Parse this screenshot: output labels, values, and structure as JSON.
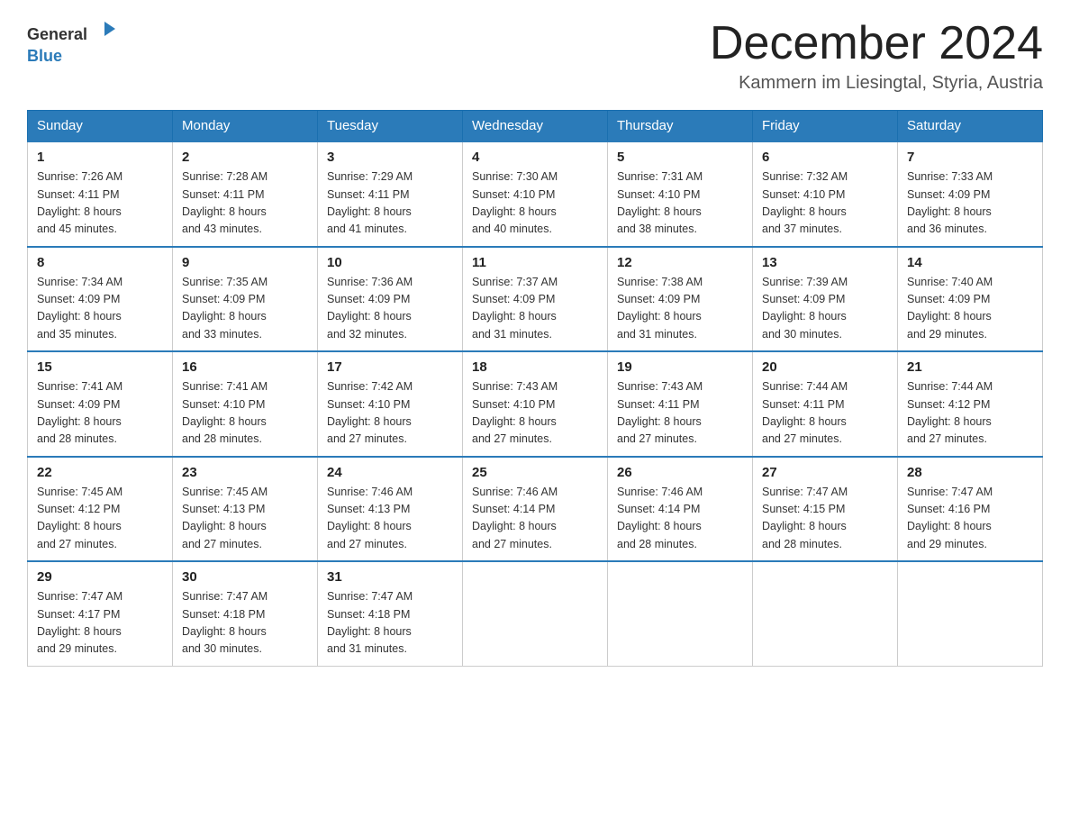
{
  "logo": {
    "text_general": "General",
    "text_blue": "Blue"
  },
  "title": {
    "month_year": "December 2024",
    "location": "Kammern im Liesingtal, Styria, Austria"
  },
  "days_of_week": [
    "Sunday",
    "Monday",
    "Tuesday",
    "Wednesday",
    "Thursday",
    "Friday",
    "Saturday"
  ],
  "weeks": [
    [
      {
        "day": "1",
        "sunrise": "7:26 AM",
        "sunset": "4:11 PM",
        "daylight": "8 hours and 45 minutes."
      },
      {
        "day": "2",
        "sunrise": "7:28 AM",
        "sunset": "4:11 PM",
        "daylight": "8 hours and 43 minutes."
      },
      {
        "day": "3",
        "sunrise": "7:29 AM",
        "sunset": "4:11 PM",
        "daylight": "8 hours and 41 minutes."
      },
      {
        "day": "4",
        "sunrise": "7:30 AM",
        "sunset": "4:10 PM",
        "daylight": "8 hours and 40 minutes."
      },
      {
        "day": "5",
        "sunrise": "7:31 AM",
        "sunset": "4:10 PM",
        "daylight": "8 hours and 38 minutes."
      },
      {
        "day": "6",
        "sunrise": "7:32 AM",
        "sunset": "4:10 PM",
        "daylight": "8 hours and 37 minutes."
      },
      {
        "day": "7",
        "sunrise": "7:33 AM",
        "sunset": "4:09 PM",
        "daylight": "8 hours and 36 minutes."
      }
    ],
    [
      {
        "day": "8",
        "sunrise": "7:34 AM",
        "sunset": "4:09 PM",
        "daylight": "8 hours and 35 minutes."
      },
      {
        "day": "9",
        "sunrise": "7:35 AM",
        "sunset": "4:09 PM",
        "daylight": "8 hours and 33 minutes."
      },
      {
        "day": "10",
        "sunrise": "7:36 AM",
        "sunset": "4:09 PM",
        "daylight": "8 hours and 32 minutes."
      },
      {
        "day": "11",
        "sunrise": "7:37 AM",
        "sunset": "4:09 PM",
        "daylight": "8 hours and 31 minutes."
      },
      {
        "day": "12",
        "sunrise": "7:38 AM",
        "sunset": "4:09 PM",
        "daylight": "8 hours and 31 minutes."
      },
      {
        "day": "13",
        "sunrise": "7:39 AM",
        "sunset": "4:09 PM",
        "daylight": "8 hours and 30 minutes."
      },
      {
        "day": "14",
        "sunrise": "7:40 AM",
        "sunset": "4:09 PM",
        "daylight": "8 hours and 29 minutes."
      }
    ],
    [
      {
        "day": "15",
        "sunrise": "7:41 AM",
        "sunset": "4:09 PM",
        "daylight": "8 hours and 28 minutes."
      },
      {
        "day": "16",
        "sunrise": "7:41 AM",
        "sunset": "4:10 PM",
        "daylight": "8 hours and 28 minutes."
      },
      {
        "day": "17",
        "sunrise": "7:42 AM",
        "sunset": "4:10 PM",
        "daylight": "8 hours and 27 minutes."
      },
      {
        "day": "18",
        "sunrise": "7:43 AM",
        "sunset": "4:10 PM",
        "daylight": "8 hours and 27 minutes."
      },
      {
        "day": "19",
        "sunrise": "7:43 AM",
        "sunset": "4:11 PM",
        "daylight": "8 hours and 27 minutes."
      },
      {
        "day": "20",
        "sunrise": "7:44 AM",
        "sunset": "4:11 PM",
        "daylight": "8 hours and 27 minutes."
      },
      {
        "day": "21",
        "sunrise": "7:44 AM",
        "sunset": "4:12 PM",
        "daylight": "8 hours and 27 minutes."
      }
    ],
    [
      {
        "day": "22",
        "sunrise": "7:45 AM",
        "sunset": "4:12 PM",
        "daylight": "8 hours and 27 minutes."
      },
      {
        "day": "23",
        "sunrise": "7:45 AM",
        "sunset": "4:13 PM",
        "daylight": "8 hours and 27 minutes."
      },
      {
        "day": "24",
        "sunrise": "7:46 AM",
        "sunset": "4:13 PM",
        "daylight": "8 hours and 27 minutes."
      },
      {
        "day": "25",
        "sunrise": "7:46 AM",
        "sunset": "4:14 PM",
        "daylight": "8 hours and 27 minutes."
      },
      {
        "day": "26",
        "sunrise": "7:46 AM",
        "sunset": "4:14 PM",
        "daylight": "8 hours and 28 minutes."
      },
      {
        "day": "27",
        "sunrise": "7:47 AM",
        "sunset": "4:15 PM",
        "daylight": "8 hours and 28 minutes."
      },
      {
        "day": "28",
        "sunrise": "7:47 AM",
        "sunset": "4:16 PM",
        "daylight": "8 hours and 29 minutes."
      }
    ],
    [
      {
        "day": "29",
        "sunrise": "7:47 AM",
        "sunset": "4:17 PM",
        "daylight": "8 hours and 29 minutes."
      },
      {
        "day": "30",
        "sunrise": "7:47 AM",
        "sunset": "4:18 PM",
        "daylight": "8 hours and 30 minutes."
      },
      {
        "day": "31",
        "sunrise": "7:47 AM",
        "sunset": "4:18 PM",
        "daylight": "8 hours and 31 minutes."
      },
      null,
      null,
      null,
      null
    ]
  ],
  "labels": {
    "sunrise": "Sunrise:",
    "sunset": "Sunset:",
    "daylight": "Daylight:"
  }
}
